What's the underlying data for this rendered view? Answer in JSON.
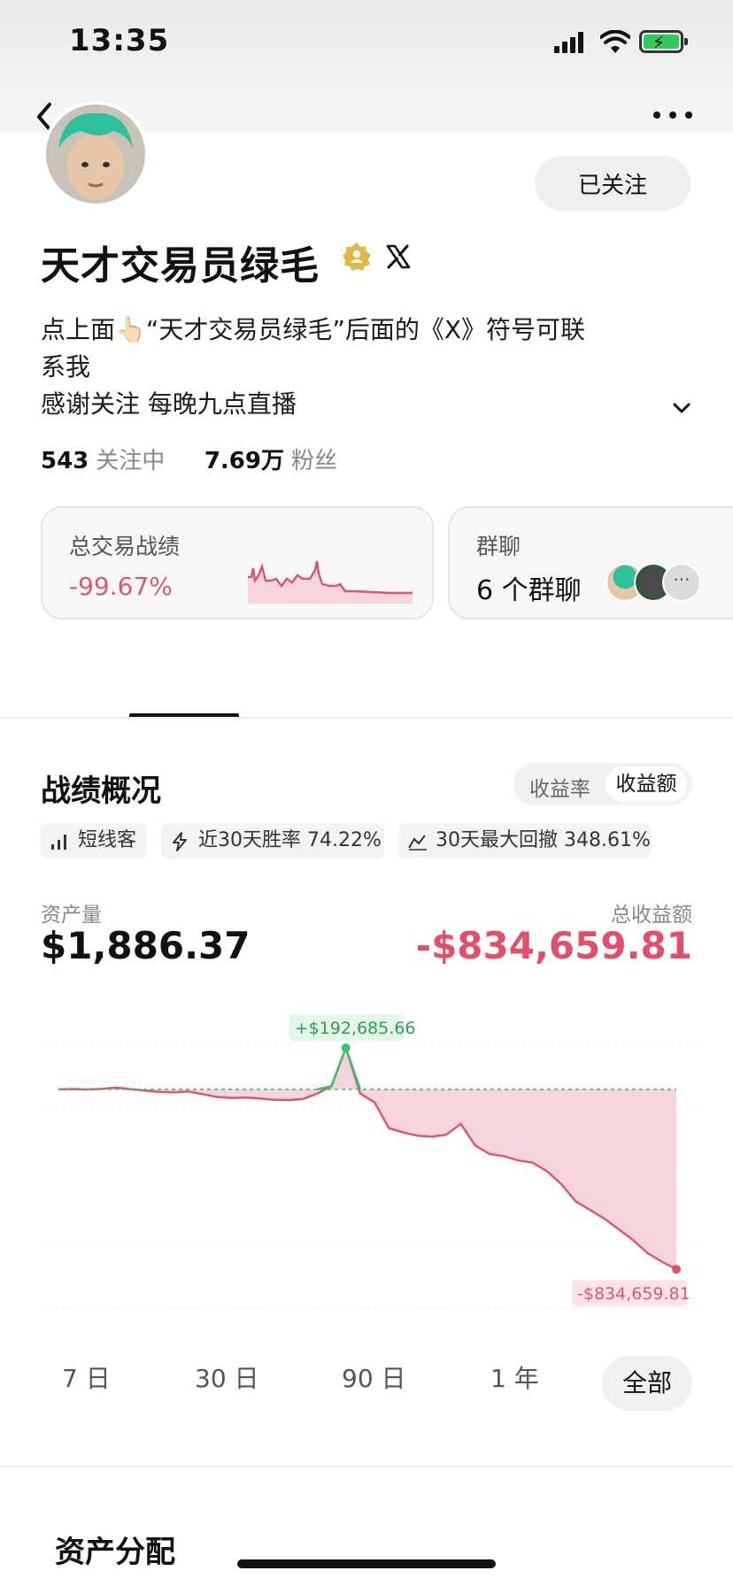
{
  "status": {
    "time": "13:35"
  },
  "profile": {
    "name": "天才交易员绿毛",
    "follow_label": "已关注",
    "bio_line1": "点上面👆🏻“天才交易员绿毛”后面的《X》符号可联",
    "bio_line2": "系我",
    "bio_line3": "感谢关注 每晚九点直播",
    "following_count": "543",
    "following_label": "关注中",
    "followers_count": "7.69万",
    "followers_label": "粉丝"
  },
  "cards": {
    "trade_title": "总交易战绩",
    "trade_value": "-99.67%",
    "group_title": "群聊",
    "group_value": "6 个群聊"
  },
  "performance": {
    "title": "战绩概况",
    "toggle": [
      "收益率",
      "收益额"
    ],
    "toggle_selected": "收益额",
    "tags": [
      "短线客",
      "近30天胜率 74.22%",
      "30天最大回撤 348.61%"
    ],
    "asset_label": "资产量",
    "asset_value": "$1,886.37",
    "pnl_label": "总收益额",
    "pnl_value": "-$834,659.81",
    "peak_label": "+$192,685.66",
    "end_label": "-$834,659.81",
    "ranges": [
      "7 日",
      "30 日",
      "90 日",
      "1 年",
      "全部"
    ],
    "range_selected": "全部"
  },
  "chart_data": {
    "type": "area",
    "title": "",
    "xlabel": "",
    "ylabel": "",
    "series": [
      {
        "values": [
          0,
          1500,
          -500,
          2000,
          8000,
          1000,
          -6000,
          -12000,
          -14000,
          -10000,
          -22000,
          -35000,
          -40000,
          -38000,
          -42000,
          -48000,
          -50000,
          -45000,
          -20000,
          15000,
          192685.66,
          -20000,
          -60000,
          -180000,
          -200000,
          -215000,
          -220000,
          -210000,
          -160000,
          -260000,
          -300000,
          -310000,
          -330000,
          -340000,
          -380000,
          -440000,
          -520000,
          -560000,
          -600000,
          -650000,
          -700000,
          -760000,
          -800000,
          -834659.81
        ]
      }
    ],
    "ylim": [
      -900000,
      250000
    ],
    "baseline": 0,
    "grid": true,
    "colors": {
      "positive": "#3fbf6a",
      "negative": "#d85a70",
      "fill": "#f3c6cf"
    }
  },
  "sections": {
    "asset_distribution": "资产分配"
  },
  "colors": {
    "accent_red": "#e0506a",
    "card_bg": "#f7f7f8"
  }
}
